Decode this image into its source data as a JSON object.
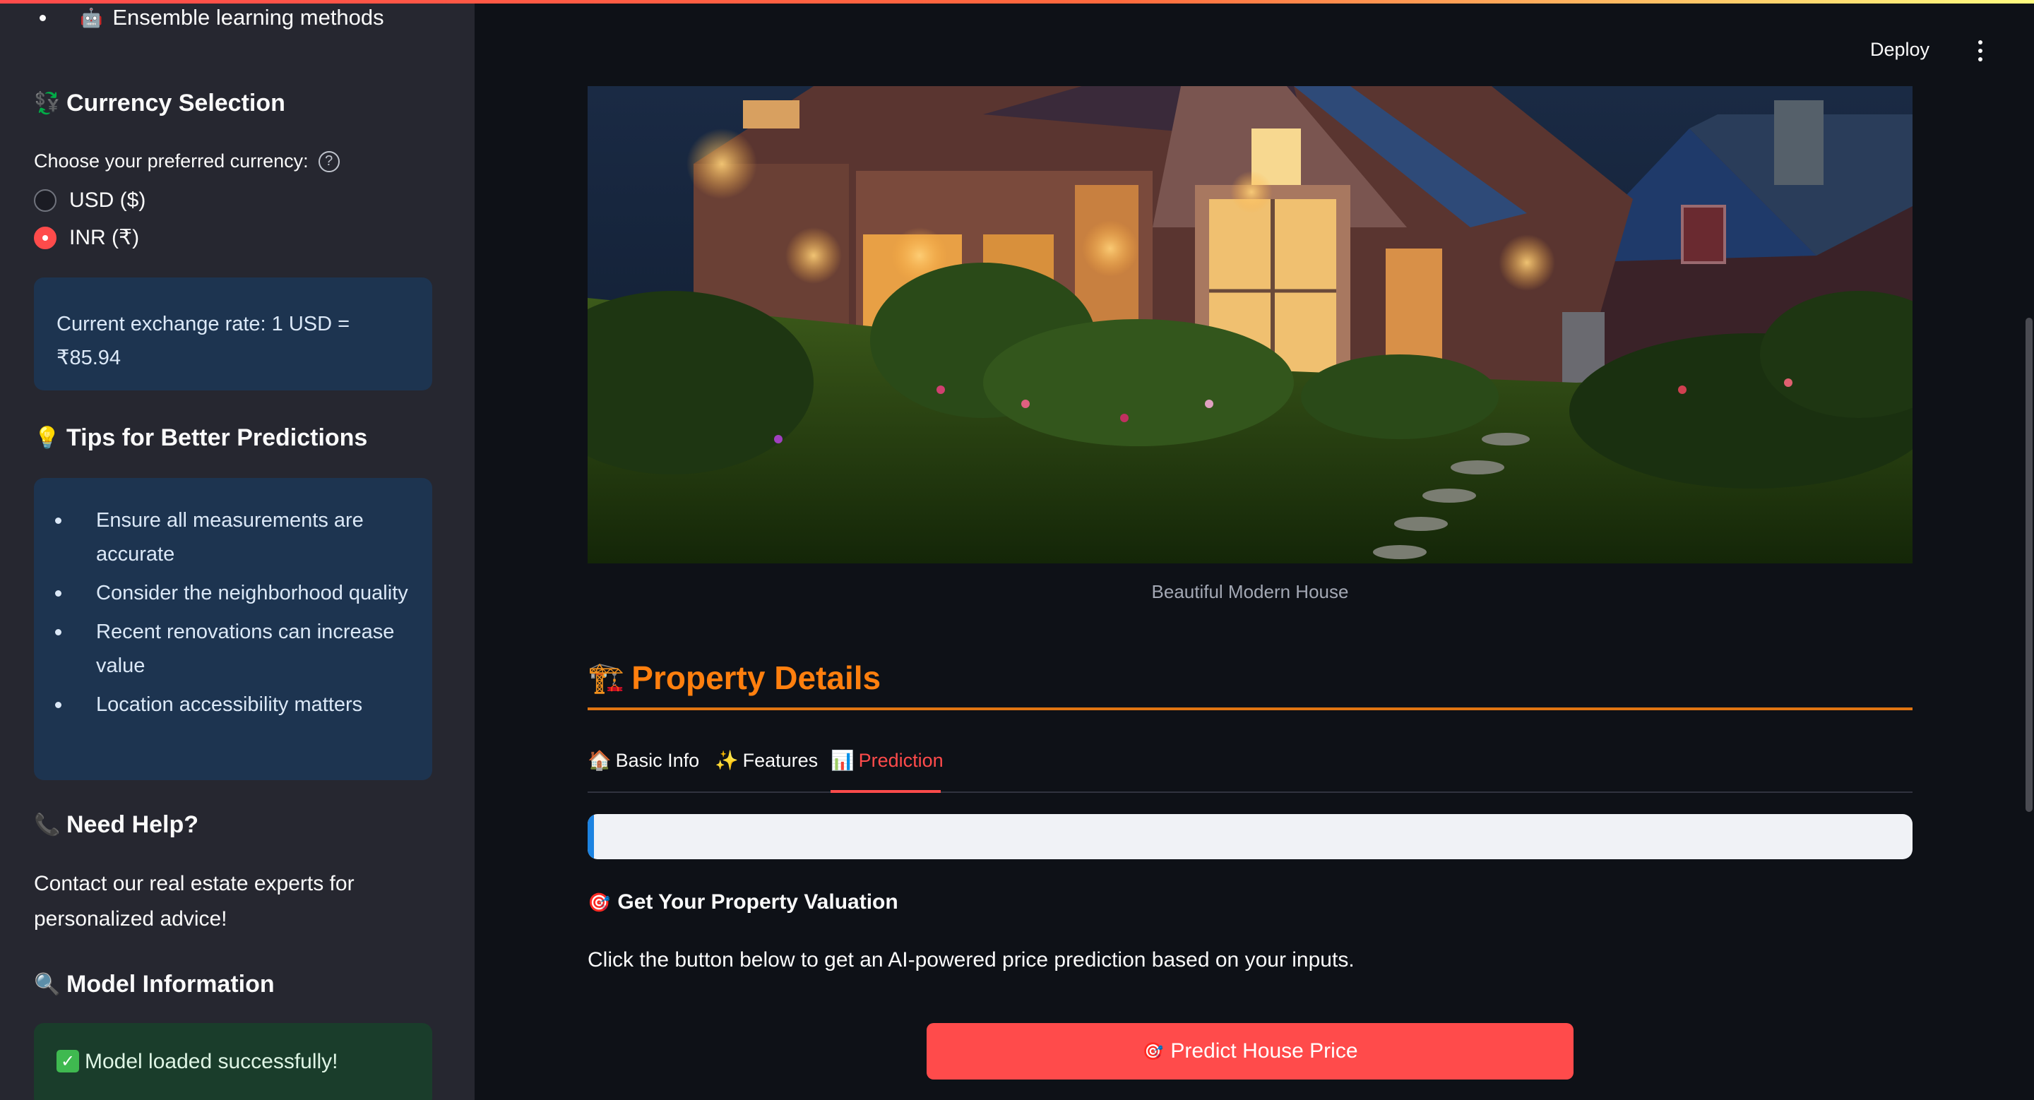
{
  "sidebar": {
    "top_item": {
      "icon": "robot-icon",
      "label": "Ensemble learning methods"
    },
    "currency": {
      "title": "Currency Selection",
      "icon": "currency-icon",
      "prompt": "Choose your preferred currency:",
      "options": [
        "USD ($)",
        "INR (₹)"
      ],
      "selected": "INR (₹)",
      "rate_line1": "Current exchange rate: 1 USD =",
      "rate_line2": "₹85.94"
    },
    "tips": {
      "title": "Tips for Better Predictions",
      "icon": "lightbulb-icon",
      "items": [
        "Ensure all measurements are accurate",
        "Consider the neighborhood quality",
        "Recent renovations can increase value",
        "Location accessibility matters"
      ]
    },
    "help": {
      "title": "Need Help?",
      "icon": "phone-icon",
      "text": "Contact our real estate experts for personalized advice!"
    },
    "model": {
      "title": "Model Information",
      "icon": "magnifier-icon",
      "status": "Model loaded successfully!"
    }
  },
  "header": {
    "deploy_label": "Deploy",
    "menu_icon": "kebab-menu-icon"
  },
  "main": {
    "image_caption": "Beautiful Modern House",
    "section_title": "Property Details",
    "section_icon": "crane-icon",
    "tabs": [
      {
        "icon": "🏠",
        "label": "Basic Info"
      },
      {
        "icon": "✨",
        "label": "Features"
      },
      {
        "icon": "📊",
        "label": "Prediction"
      }
    ],
    "active_tab": "Prediction",
    "progress": 0.005,
    "valuation_title": "Get Your Property Valuation",
    "valuation_icon": "target-icon",
    "description": "Click the button below to get an AI-powered price prediction based on your inputs.",
    "predict_button": "Predict House Price"
  },
  "colors": {
    "accent": "#ff4b4b",
    "section_title": "#ff7f0e",
    "background": "#0e1117",
    "sidebar": "#262730"
  }
}
